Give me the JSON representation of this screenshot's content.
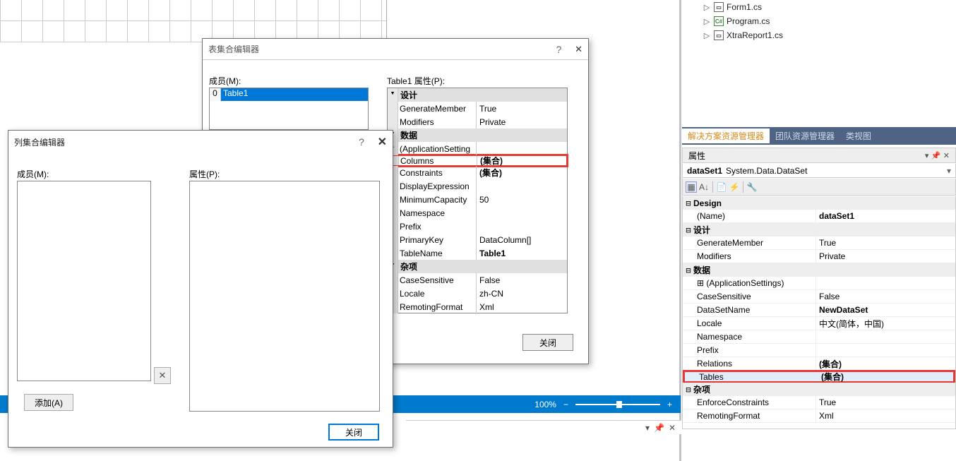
{
  "tree": {
    "items": [
      "Form1.cs",
      "Program.cs",
      "XtraReport1.cs"
    ]
  },
  "solution_tabs": [
    "解决方案资源管理器",
    "团队资源管理器",
    "类视图"
  ],
  "prop_panel": {
    "title": "属性",
    "object_name": "dataSet1",
    "object_type": "System.Data.DataSet",
    "cats": [
      {
        "expand": "⊟",
        "name": "Design",
        "rows": [
          {
            "n": "(Name)",
            "v": "dataSet1",
            "b": true
          }
        ]
      },
      {
        "expand": "⊟",
        "name": "设计",
        "rows": [
          {
            "n": "GenerateMember",
            "v": "True"
          },
          {
            "n": "Modifiers",
            "v": "Private"
          }
        ]
      },
      {
        "expand": "⊟",
        "name": "数据",
        "rows": [
          {
            "n": "(ApplicationSettings)",
            "v": "",
            "exp": "⊞"
          },
          {
            "n": "CaseSensitive",
            "v": "False"
          },
          {
            "n": "DataSetName",
            "v": "NewDataSet",
            "b": true
          },
          {
            "n": "Locale",
            "v": "中文(简体，中国)"
          },
          {
            "n": "Namespace",
            "v": ""
          },
          {
            "n": "Prefix",
            "v": ""
          },
          {
            "n": "Relations",
            "v": "(集合)",
            "b": true
          },
          {
            "n": "Tables",
            "v": "(集合)",
            "b": true,
            "hl": true
          }
        ]
      },
      {
        "expand": "⊟",
        "name": "杂项",
        "rows": [
          {
            "n": "EnforceConstraints",
            "v": "True"
          },
          {
            "n": "RemotingFormat",
            "v": "Xml"
          }
        ]
      }
    ]
  },
  "zoom": "100%",
  "dlg_table": {
    "title": "表集合编辑器",
    "member_lbl": "成员(M):",
    "prop_lbl": "Table1 属性(P):",
    "item_idx": "0",
    "item_name": "Table1",
    "close": "关闭",
    "cats": [
      {
        "name": "设计",
        "rows": [
          {
            "n": "GenerateMember",
            "v": "True"
          },
          {
            "n": "Modifiers",
            "v": "Private"
          }
        ]
      },
      {
        "name": "数据",
        "rows": [
          {
            "n": "(ApplicationSetting",
            "v": "",
            "exp": true
          },
          {
            "n": "Columns",
            "v": "(集合)",
            "hl": true,
            "b": true
          },
          {
            "n": "Constraints",
            "v": "(集合)",
            "b": true
          },
          {
            "n": "DisplayExpression",
            "v": ""
          },
          {
            "n": "MinimumCapacity",
            "v": "50"
          },
          {
            "n": "Namespace",
            "v": ""
          },
          {
            "n": "Prefix",
            "v": ""
          },
          {
            "n": "PrimaryKey",
            "v": "DataColumn[]"
          },
          {
            "n": "TableName",
            "v": "Table1",
            "b": true
          }
        ]
      },
      {
        "name": "杂项",
        "rows": [
          {
            "n": "CaseSensitive",
            "v": "False"
          },
          {
            "n": "Locale",
            "v": "zh-CN"
          },
          {
            "n": "RemotingFormat",
            "v": "Xml"
          }
        ]
      }
    ]
  },
  "dlg_col": {
    "title": "列集合编辑器",
    "member_lbl": "成员(M):",
    "prop_lbl": "属性(P):",
    "add": "添加(A)",
    "close": "关闭"
  }
}
